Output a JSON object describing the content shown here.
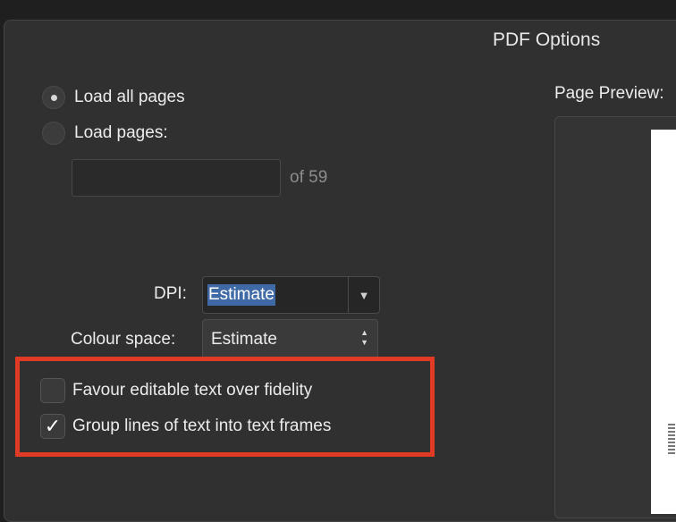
{
  "dialog": {
    "title": "PDF Options"
  },
  "load_options": {
    "all_pages_label": "Load all pages",
    "pages_label": "Load pages:",
    "pages_value": "",
    "of_total": "of 59"
  },
  "dpi": {
    "label": "DPI:",
    "value": "Estimate"
  },
  "colour_space": {
    "label": "Colour space:",
    "value": "Estimate"
  },
  "options": {
    "favour_editable": {
      "label": "Favour editable text over fidelity",
      "checked": false
    },
    "group_lines": {
      "label": "Group lines of text into text frames",
      "checked": true
    }
  },
  "preview": {
    "label": "Page Preview:"
  },
  "colors": {
    "highlight": "#e23b25",
    "selection": "#3f6aa6",
    "background": "#303030"
  },
  "icons": {
    "dropdown": "triangle-down-icon",
    "stepper": "up-down-chevron-icon",
    "check": "checkmark-icon"
  }
}
